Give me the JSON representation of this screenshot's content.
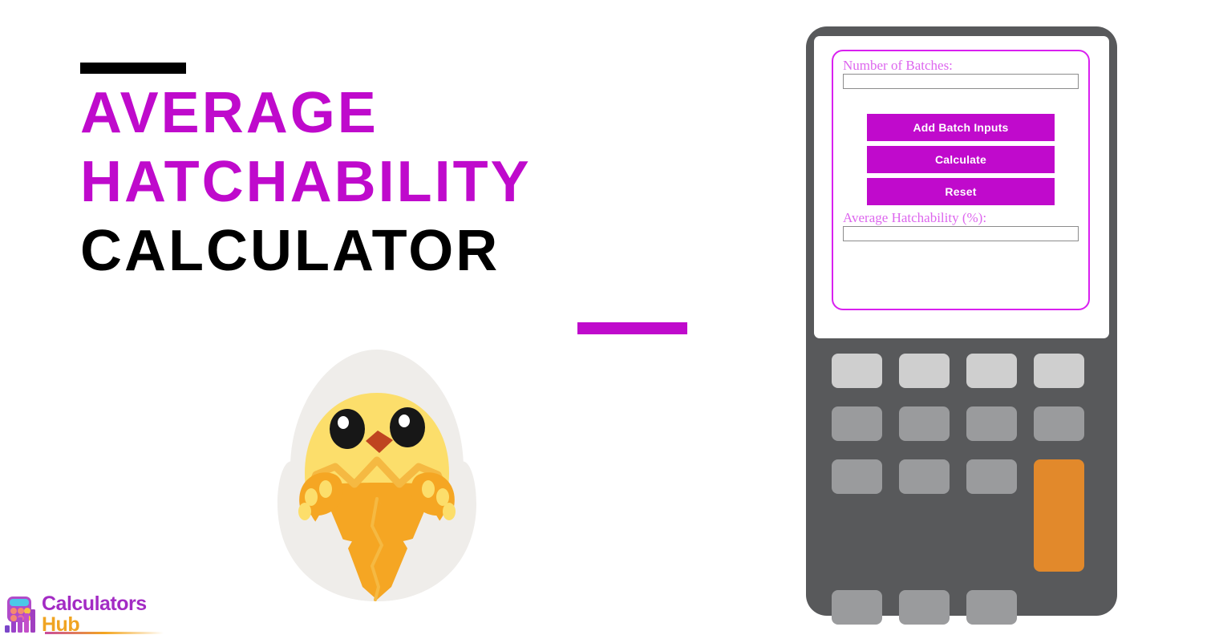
{
  "hero": {
    "title_lines": [
      {
        "text": "Average",
        "color": "#BF0ACC"
      },
      {
        "text": "Hatchability",
        "color": "#BF0ACC"
      },
      {
        "text": "Calculator",
        "color": "#000000"
      }
    ],
    "rule_top_color": "#000000",
    "rule_bottom_color": "#BF0ACC",
    "illustration": "hatching-chick-in-egg"
  },
  "brand": {
    "name_line1": "Calculators",
    "name_line2": "Hub",
    "line1_color": "#A32BC4",
    "line2_color": "#F0A422",
    "mark": "calculator-bar-chart-icon"
  },
  "calculator": {
    "device_color": "#58595B",
    "screen_color": "#FFFFFF",
    "form_border_color": "#D920F0",
    "accent_color": "#C00ACC",
    "fields": [
      {
        "id": "batches",
        "label": "Number of Batches:",
        "value": "",
        "placeholder": ""
      },
      {
        "id": "average-hatchability",
        "label": "Average Hatchability (%):",
        "value": "",
        "placeholder": ""
      }
    ],
    "buttons": [
      {
        "id": "add-batch-inputs",
        "label": "Add Batch Inputs"
      },
      {
        "id": "calculate",
        "label": "Calculate"
      },
      {
        "id": "reset",
        "label": "Reset"
      }
    ],
    "keypad": {
      "light_key_color": "#CFCFCF",
      "key_color": "#9A9B9D",
      "accent_key_color": "#E2892B",
      "rows": [
        [
          "light",
          "light",
          "light",
          "light"
        ],
        [
          "normal",
          "normal",
          "normal",
          "normal"
        ],
        [
          "normal",
          "normal",
          "normal",
          "accent"
        ],
        [
          "normal",
          "normal",
          "normal",
          "spacer"
        ]
      ]
    }
  }
}
